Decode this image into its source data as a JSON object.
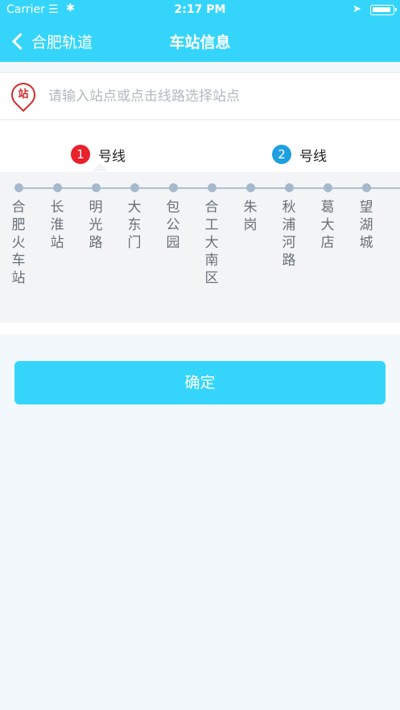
{
  "status_bar": {
    "carrier": "Carrier",
    "time": "2:17 PM"
  },
  "nav": {
    "back_label": "合肥轨道",
    "title": "车站信息"
  },
  "search": {
    "pin_text": "站",
    "placeholder": "请输入站点或点击线路选择站点"
  },
  "lines": [
    {
      "number": "1",
      "label": "号线",
      "color": "#e8212c",
      "selected": true
    },
    {
      "number": "2",
      "label": "号线",
      "color": "#1ea0e0",
      "selected": false
    }
  ],
  "stations": [
    "合肥火车站",
    "长淮站",
    "明光路",
    "大东门",
    "包公园",
    "合工大南区",
    "朱岗",
    "秋浦河路",
    "葛大店",
    "望湖城"
  ],
  "confirm_label": "确定",
  "colors": {
    "accent": "#35d5fb"
  }
}
